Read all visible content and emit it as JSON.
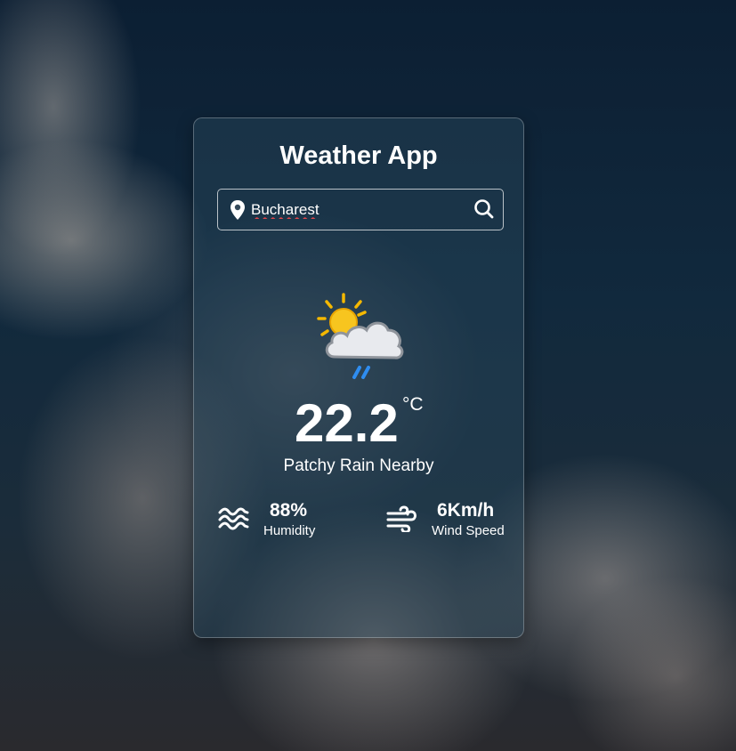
{
  "app": {
    "title": "Weather App"
  },
  "search": {
    "value": "Bucharest",
    "placeholder": ""
  },
  "icons": {
    "location": "map-pin-icon",
    "search": "search-icon",
    "weather": "sun-cloud-rain-icon",
    "humidity": "water-waves-icon",
    "wind": "wind-icon"
  },
  "weather": {
    "temperature": "22.2",
    "unit": "°C",
    "condition": "Patchy Rain Nearby"
  },
  "details": {
    "humidity": {
      "value": "88%",
      "label": "Humidity"
    },
    "wind": {
      "value": "6Km/h",
      "label": "Wind Speed"
    }
  },
  "colors": {
    "text": "#ffffff",
    "sun": "#f5b800",
    "rain": "#2f8df0",
    "cloud": "#e8eaee"
  }
}
